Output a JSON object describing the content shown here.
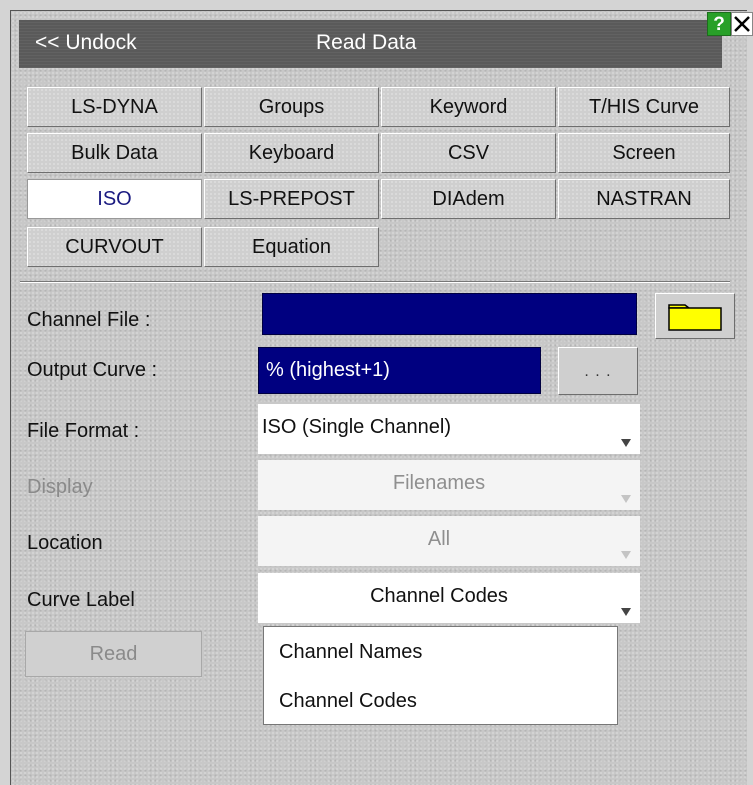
{
  "window": {
    "undock_label": "<< Undock",
    "title": "Read Data",
    "help_label": "?",
    "accent_help": "#28a028"
  },
  "tabs": [
    {
      "label": "LS-DYNA",
      "active": false
    },
    {
      "label": "Groups",
      "active": false
    },
    {
      "label": "Keyword",
      "active": false
    },
    {
      "label": "T/HIS Curve",
      "active": false
    },
    {
      "label": "Bulk Data",
      "active": false
    },
    {
      "label": "Keyboard",
      "active": false
    },
    {
      "label": "CSV",
      "active": false
    },
    {
      "label": "Screen",
      "active": false
    },
    {
      "label": "ISO",
      "active": true
    },
    {
      "label": "LS-PREPOST",
      "active": false
    },
    {
      "label": "DIAdem",
      "active": false
    },
    {
      "label": "NASTRAN",
      "active": false
    },
    {
      "label": "CURVOUT",
      "active": false
    },
    {
      "label": "Equation",
      "active": false
    }
  ],
  "form": {
    "channel_file": {
      "label": "Channel File :",
      "value": ""
    },
    "output_curve": {
      "label": "Output Curve :",
      "value": "% (highest+1)",
      "more_label": ". . ."
    },
    "file_format": {
      "label": "File Format :",
      "value": "ISO (Single Channel)"
    },
    "display": {
      "label": "Display",
      "value": "Filenames",
      "enabled": false
    },
    "location": {
      "label": "Location",
      "value": "All",
      "enabled": false
    },
    "curve_label": {
      "label": "Curve Label",
      "value": "Channel Codes"
    }
  },
  "read_button": {
    "label": "Read",
    "enabled": false
  },
  "curve_label_menu": {
    "options": [
      "Channel Names",
      "Channel Codes"
    ]
  },
  "colors": {
    "field_navy": "#000080",
    "folder_yellow": "#ffff00"
  }
}
